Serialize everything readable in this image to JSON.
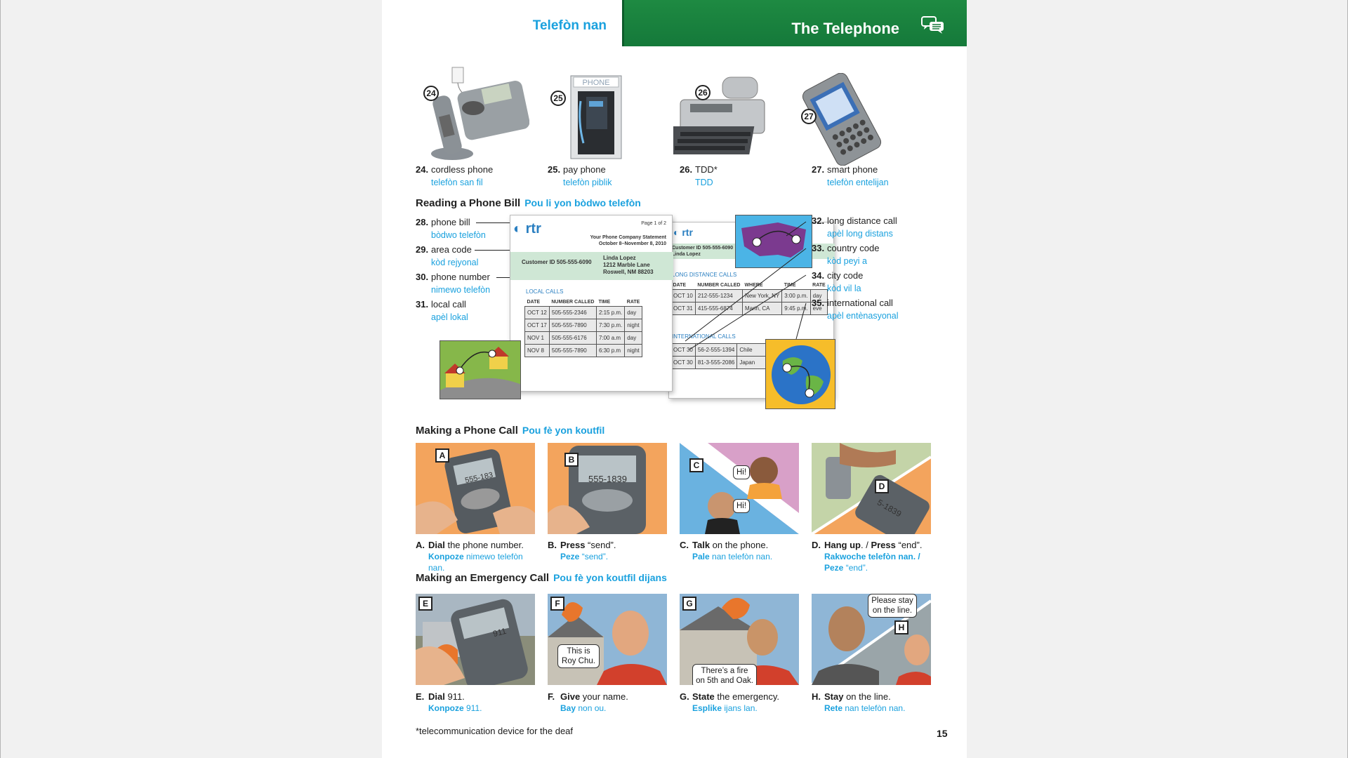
{
  "header": {
    "left_title": "Telefòn nan",
    "right_title": "The Telephone",
    "icon": "speech-bubbles-icon"
  },
  "top_items": [
    {
      "num": "24.",
      "en": "cordless phone",
      "ht": "telefòn san fil",
      "badge": "24"
    },
    {
      "num": "25.",
      "en": "pay phone",
      "ht": "telefòn piblik",
      "badge": "25"
    },
    {
      "num": "26.",
      "en": "TDD*",
      "ht": "TDD",
      "badge": "26"
    },
    {
      "num": "27.",
      "en": "smart phone",
      "ht": "telefòn entelijan",
      "badge": "27"
    }
  ],
  "reading": {
    "title": "Reading a Phone Bill",
    "title_ht": "Pou li yon bòdwo telefòn",
    "left_items": [
      {
        "num": "28.",
        "en": "phone bill",
        "ht": "bòdwo telefòn"
      },
      {
        "num": "29.",
        "en": "area code",
        "ht": "kòd rejyonal"
      },
      {
        "num": "30.",
        "en": "phone number",
        "ht": "nimewo telefòn"
      },
      {
        "num": "31.",
        "en": "local call",
        "ht": "apèl lokal"
      }
    ],
    "right_items": [
      {
        "num": "32.",
        "en": "long distance call",
        "ht": "apèl long distans"
      },
      {
        "num": "33.",
        "en": "country code",
        "ht": "kòd peyi a"
      },
      {
        "num": "34.",
        "en": "city code",
        "ht": "kòd vil la"
      },
      {
        "num": "35.",
        "en": "international call",
        "ht": "apèl entènasyonal"
      }
    ],
    "bill1": {
      "logo": "rtr",
      "page": "Page 1 of 2",
      "company": "Your Phone Company Statement",
      "period": "October 8–November 8, 2010",
      "customer": "Customer ID 505-555-6090",
      "name": "Linda Lopez",
      "addr1": "1212 Marble Lane",
      "addr2": "Roswell, NM 88203",
      "section": "LOCAL CALLS",
      "headers": [
        "DATE",
        "NUMBER CALLED",
        "TIME",
        "RATE"
      ],
      "rows": [
        [
          "OCT 12",
          "505-555-2346",
          "2:15 p.m.",
          "day"
        ],
        [
          "OCT 17",
          "505-555-7890",
          "7:30 p.m.",
          "night"
        ],
        [
          "NOV 1",
          "505-555-6176",
          "7:00 a.m",
          "day"
        ],
        [
          "NOV 8",
          "505-555-7890",
          "6:30 p.m",
          "night"
        ]
      ]
    },
    "bill2": {
      "logo": "rtr",
      "customer": "Customer ID 505-555-6090",
      "name": "Linda Lopez",
      "section_ld": "LONG DISTANCE  CALLS",
      "headers": [
        "DATE",
        "NUMBER CALLED",
        "WHERE",
        "TIME",
        "RATE"
      ],
      "ld_rows": [
        [
          "OCT 10",
          "212-555-1234",
          "New York, NY",
          "3:00 p.m.",
          "day"
        ],
        [
          "OCT 31",
          "415-555-6874",
          "Marin, CA",
          "9:45 p.m.",
          "eve"
        ]
      ],
      "section_int": "INTERNATIONAL  CALLS",
      "int_rows": [
        [
          "OCT 30",
          "56-2-555-1394",
          "Chile"
        ],
        [
          "OCT 30",
          "81-3-555-2086",
          "Japan"
        ]
      ]
    }
  },
  "making_call": {
    "title": "Making a Phone Call",
    "title_ht": "Pou fè yon koutfil",
    "steps": [
      {
        "letter": "A",
        "l": "A.",
        "verb": "Dial",
        "rest": " the phone number.",
        "ht_verb": "Konpoze",
        "ht_rest": " nimewo telefòn nan.",
        "screen": "555-183"
      },
      {
        "letter": "B",
        "l": "B.",
        "verb": "Press",
        "rest": " “send”.",
        "ht_verb": "Peze",
        "ht_rest": " “send”.",
        "screen": "555-1839"
      },
      {
        "letter": "C",
        "l": "C.",
        "verb": "Talk",
        "rest": " on the phone.",
        "ht_verb": "Pale",
        "ht_rest": " nan telefòn nan.",
        "bubble1": "Hi!",
        "bubble2": "Hi!"
      },
      {
        "letter": "D",
        "l": "D.",
        "verb": "Hang up",
        "mid": ". / ",
        "verb2": "Press",
        "rest": " “end”.",
        "ht_verb": "Rakwoche telefòn nan. /",
        "ht_verb2": "Peze",
        "ht_rest": " “end”.",
        "screen": "5-1839"
      }
    ]
  },
  "emergency": {
    "title": "Making an Emergency Call",
    "title_ht": "Pou fè yon koutfil dijans",
    "steps": [
      {
        "letter": "E",
        "l": "E.",
        "verb": "Dial",
        "rest": " 911.",
        "ht_verb": "Konpoze",
        "ht_rest": " 911.",
        "screen": "911"
      },
      {
        "letter": "F",
        "l": "F.",
        "verb": "Give",
        "rest": " your name.",
        "ht_verb": "Bay",
        "ht_rest": " non ou.",
        "bubble": "This is Roy Chu."
      },
      {
        "letter": "G",
        "l": "G.",
        "verb": "State",
        "rest": " the emergency.",
        "ht_verb": "Esplike",
        "ht_rest": " ijans lan.",
        "bubble": "There’s a fire on 5th and Oak."
      },
      {
        "letter": "H",
        "l": "H.",
        "verb": "Stay",
        "rest": " on the line.",
        "ht_verb": "Rete",
        "ht_rest": " nan telefòn nan.",
        "bubble": "Please stay on the line."
      }
    ]
  },
  "footnote": "*telecommunication device for the deaf",
  "page_number": "15"
}
